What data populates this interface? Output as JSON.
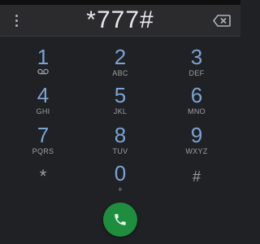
{
  "dialer": {
    "number": "*777#",
    "keys": [
      {
        "digit": "1",
        "letters": "",
        "icon": "voicemail-icon"
      },
      {
        "digit": "2",
        "letters": "ABC"
      },
      {
        "digit": "3",
        "letters": "DEF"
      },
      {
        "digit": "4",
        "letters": "GHI"
      },
      {
        "digit": "5",
        "letters": "JKL"
      },
      {
        "digit": "6",
        "letters": "MNO"
      },
      {
        "digit": "7",
        "letters": "PQRS"
      },
      {
        "digit": "8",
        "letters": "TUV"
      },
      {
        "digit": "9",
        "letters": "WXYZ"
      },
      {
        "digit": "*",
        "letters": ""
      },
      {
        "digit": "0",
        "letters": "+"
      },
      {
        "digit": "#",
        "letters": ""
      }
    ],
    "icons": {
      "menu": "more-vert-icon",
      "delete": "backspace-icon",
      "call": "phone-icon"
    }
  },
  "colors": {
    "background": "#202124",
    "digit": "#7aa4d4",
    "call_button": "#1e8e3e"
  }
}
